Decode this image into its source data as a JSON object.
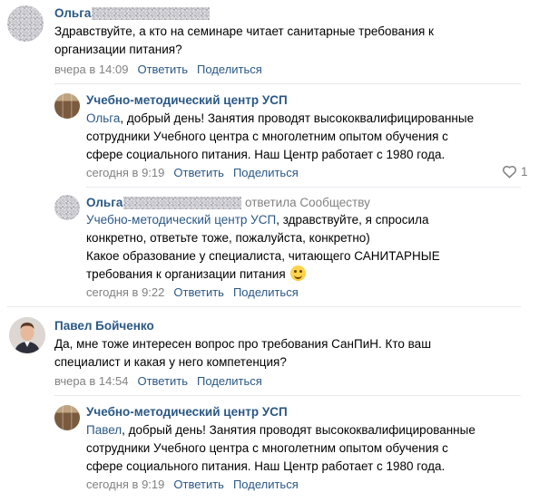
{
  "comments": [
    {
      "author": "Ольга",
      "lines": [
        "Здравствуйте, а кто на семинаре читает санитарные требования к",
        "организации питания?"
      ],
      "time": "вчера в 14:09",
      "reply_label": "Ответить",
      "share_label": "Поделиться"
    },
    {
      "author": "Учебно-методический центр УСП",
      "mention": "Ольга",
      "lines": [
        ", добрый день! Занятия проводят высококвалифицированные",
        "сотрудники Учебного центра с многолетним опытом обучения с",
        "сфере социального питания. Наш Центр работает с 1980 года."
      ],
      "time": "сегодня в 9:19",
      "reply_label": "Ответить",
      "share_label": "Поделиться",
      "likes": "1"
    },
    {
      "author": "Ольга",
      "replied_to": "ответила Сообществу",
      "mention": "Учебно-методический центр УСП",
      "lines": [
        ", здравствуйте, я спросила",
        "конкретно, ответьте тоже, пожалуйста, конкретно)",
        "Какое образование у специалиста, читающего САНИТАРНЫЕ",
        "требования к организации питания"
      ],
      "time": "сегодня в 9:22",
      "reply_label": "Ответить",
      "share_label": "Поделиться"
    },
    {
      "author": "Павел Бойченко",
      "lines": [
        "Да, мне тоже интересен вопрос про требования СанПиН. Кто ваш",
        "специалист и какая у него компетенция?"
      ],
      "time": "вчера в 14:54",
      "reply_label": "Ответить",
      "share_label": "Поделиться"
    },
    {
      "author": "Учебно-методический центр УСП",
      "mention": "Павел",
      "lines": [
        ", добрый день! Занятия проводят высококвалифицированные",
        "сотрудники Учебного центра с многолетним опытом обучения с",
        "сфере социального питания. Наш Центр работает с 1980 года."
      ],
      "time": "сегодня в 9:19",
      "reply_label": "Ответить",
      "share_label": "Поделиться"
    }
  ],
  "icons": {
    "like": "heart-outline-icon",
    "emoji": "smiling-face-emoji"
  },
  "colors": {
    "link": "#2a5885",
    "meta": "#828282",
    "separator": "#e7e8ec"
  }
}
